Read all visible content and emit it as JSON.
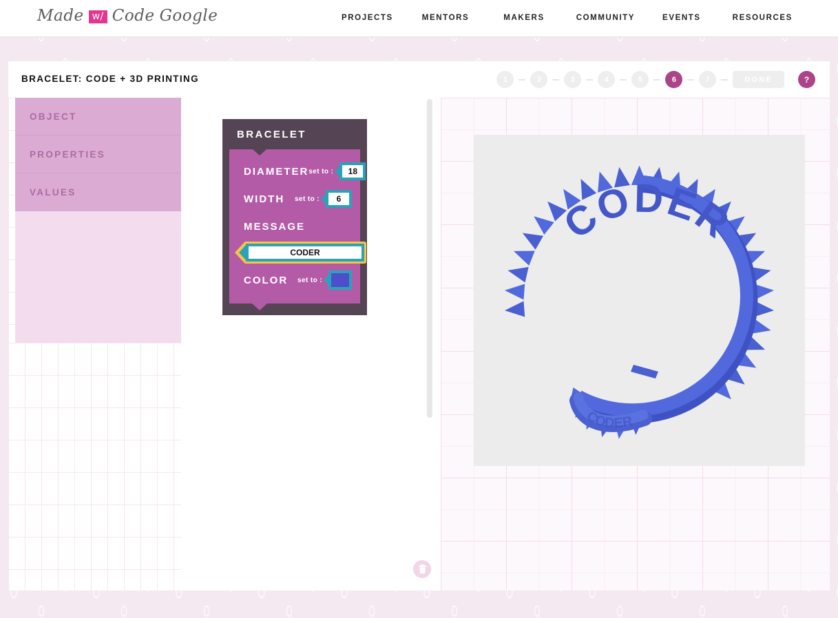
{
  "brand": {
    "word1": "Made",
    "badge": "w/",
    "word2": "Code",
    "word3": "Google"
  },
  "nav": {
    "items": [
      {
        "label": "PROJECTS"
      },
      {
        "label": "MENTORS"
      },
      {
        "label": "MAKERS"
      },
      {
        "label": "COMMUNITY"
      },
      {
        "label": "EVENTS"
      },
      {
        "label": "RESOURCES"
      }
    ]
  },
  "header": {
    "title": "BRACELET: CODE + 3D PRINTING",
    "steps": [
      {
        "label": "1",
        "active": false
      },
      {
        "label": "2",
        "active": false
      },
      {
        "label": "3",
        "active": false
      },
      {
        "label": "4",
        "active": false
      },
      {
        "label": "5",
        "active": false
      },
      {
        "label": "6",
        "active": true
      },
      {
        "label": "7",
        "active": false
      }
    ],
    "done_label": "DONE",
    "help_label": "?"
  },
  "sidebar": {
    "items": [
      {
        "label": "OBJECT"
      },
      {
        "label": "PROPERTIES"
      },
      {
        "label": "VALUES"
      }
    ]
  },
  "code_block": {
    "title": "BRACELET",
    "set_to_label": "set to :",
    "properties": [
      {
        "name": "DIAMETER",
        "value": "18"
      },
      {
        "name": "WIDTH",
        "value": "6"
      },
      {
        "name": "MESSAGE",
        "value": "CODER"
      },
      {
        "name": "COLOR",
        "value": "#4d4ecb"
      }
    ]
  },
  "workspace": {
    "trash_tooltip": "Delete"
  },
  "preview": {
    "model_text": "CODER",
    "model_color": "#4a5fd0"
  },
  "colors": {
    "accent_magenta": "#ab4488",
    "brand_pink": "#e2368f",
    "block_outer": "#554454",
    "block_inner": "#b45ba8",
    "chip_teal": "#2ba2b8",
    "highlight_gold": "#f5c544",
    "sidebar_bg": "#dcabd4",
    "sidebar_panel": "#f2dcee",
    "canvas_bg": "#ececec"
  }
}
